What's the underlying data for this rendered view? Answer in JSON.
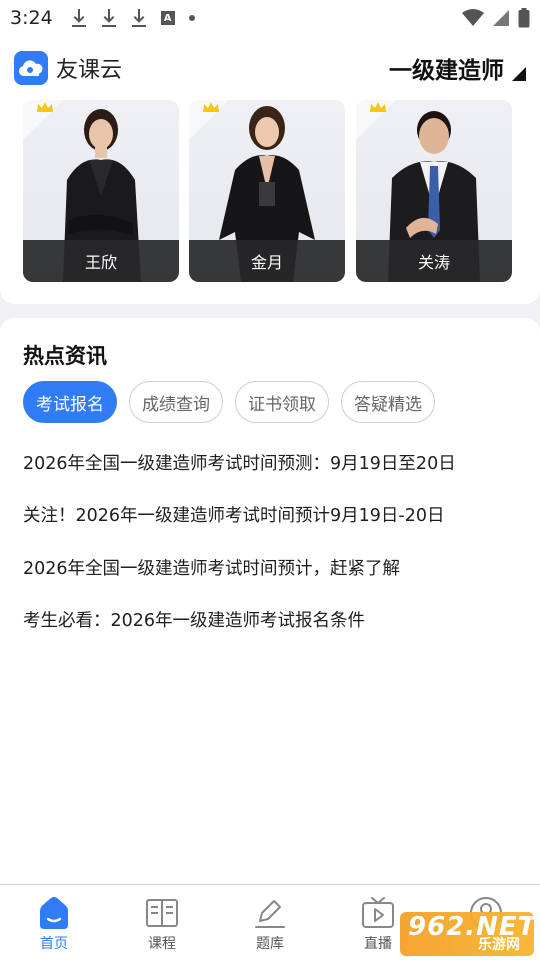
{
  "status_bar": {
    "time": "3:24"
  },
  "header": {
    "brand": "友课云",
    "exam": "一级建造师"
  },
  "teachers": [
    {
      "name": "王欣"
    },
    {
      "name": "金月"
    },
    {
      "name": "关涛"
    }
  ],
  "news": {
    "title": "热点资讯",
    "tabs": [
      "考试报名",
      "成绩查询",
      "证书领取",
      "答疑精选"
    ],
    "active_tab": "考试报名",
    "items": [
      "2026年全国一级建造师考试时间预测：9月19日至20日",
      "关注！2026年一级建造师考试时间预计9月19日-20日",
      "2026年全国一级建造师考试时间预计，赶紧了解",
      "考生必看：2026年一级建造师考试报名条件"
    ]
  },
  "tabbar": {
    "items": [
      {
        "label": "首页",
        "icon": "home-icon"
      },
      {
        "label": "课程",
        "icon": "course-icon"
      },
      {
        "label": "题库",
        "icon": "pencil-icon"
      },
      {
        "label": "直播",
        "icon": "tv-play-icon"
      },
      {
        "label": "",
        "icon": "user-icon"
      }
    ],
    "active": "首页"
  },
  "watermark": {
    "text": "962.NET",
    "sub": "乐游网"
  },
  "colors": {
    "accent": "#2f7cf6",
    "name_bar": "#28282a"
  }
}
